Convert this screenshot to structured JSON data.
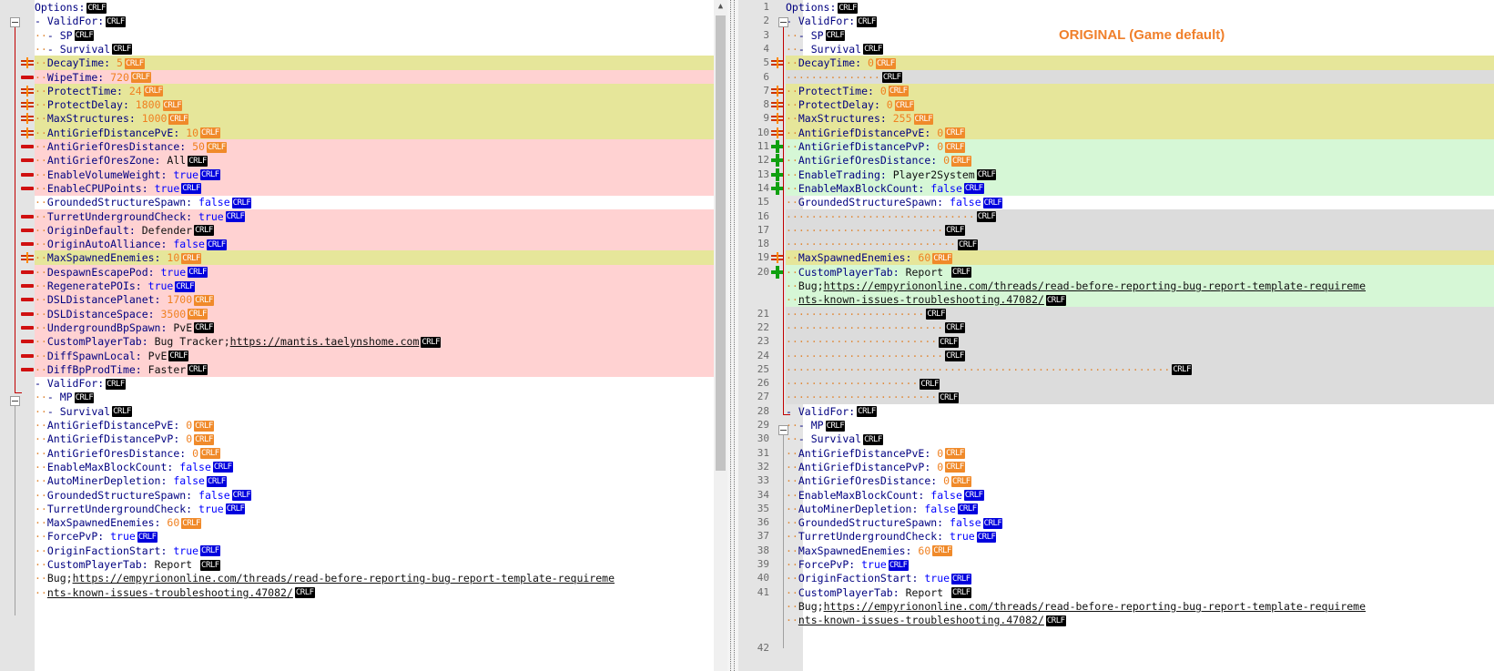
{
  "annotation": "ORIGINAL (Game default)",
  "colors": {
    "deleted": "#ffd2d2",
    "changed": "#e6e69a",
    "added": "#d6f7d6",
    "padding": "#dcdcdc",
    "annotation": "#f07f2a"
  },
  "left": {
    "rows": [
      {
        "t": "n",
        "i": 0,
        "k": "Options:",
        "e": "k"
      },
      {
        "t": "n",
        "i": 0,
        "k": "- ValidFor:",
        "e": "k"
      },
      {
        "t": "n",
        "i": 2,
        "k": "- SP",
        "e": "k"
      },
      {
        "t": "n",
        "i": 2,
        "k": "- Survival",
        "e": "k"
      },
      {
        "t": "c",
        "i": 2,
        "k": "DecayTime: ",
        "v": "5",
        "vt": "n"
      },
      {
        "t": "d",
        "i": 2,
        "k": "WipeTime: ",
        "v": "720",
        "vt": "n"
      },
      {
        "t": "c",
        "i": 2,
        "k": "ProtectTime: ",
        "v": "24",
        "vt": "n"
      },
      {
        "t": "c",
        "i": 2,
        "k": "ProtectDelay: ",
        "v": "1800",
        "vt": "n"
      },
      {
        "t": "c",
        "i": 2,
        "k": "MaxStructures: ",
        "v": "1000",
        "vt": "n"
      },
      {
        "t": "c",
        "i": 2,
        "k": "AntiGriefDistancePvE: ",
        "v": "10",
        "vt": "n"
      },
      {
        "t": "d",
        "i": 2,
        "k": "AntiGriefOresDistance: ",
        "v": "50",
        "vt": "n"
      },
      {
        "t": "d",
        "i": 2,
        "k": "AntiGriefOresZone: ",
        "v": "All",
        "vt": "s"
      },
      {
        "t": "d",
        "i": 2,
        "k": "EnableVolumeWeight: ",
        "v": "true",
        "vt": "b"
      },
      {
        "t": "d",
        "i": 2,
        "k": "EnableCPUPoints: ",
        "v": "true",
        "vt": "b"
      },
      {
        "t": "n",
        "i": 2,
        "k": "GroundedStructureSpawn: ",
        "v": "false",
        "vt": "b"
      },
      {
        "t": "d",
        "i": 2,
        "k": "TurretUndergroundCheck: ",
        "v": "true",
        "vt": "b"
      },
      {
        "t": "d",
        "i": 2,
        "k": "OriginDefault: ",
        "v": "Defender",
        "vt": "s"
      },
      {
        "t": "d",
        "i": 2,
        "k": "OriginAutoAlliance: ",
        "v": "false",
        "vt": "b"
      },
      {
        "t": "c",
        "i": 2,
        "k": "MaxSpawnedEnemies: ",
        "v": "10",
        "vt": "n"
      },
      {
        "t": "d",
        "i": 2,
        "k": "DespawnEscapePod: ",
        "v": "true",
        "vt": "b"
      },
      {
        "t": "d",
        "i": 2,
        "k": "RegeneratePOIs: ",
        "v": "true",
        "vt": "b"
      },
      {
        "t": "d",
        "i": 2,
        "k": "DSLDistancePlanet: ",
        "v": "1700",
        "vt": "n"
      },
      {
        "t": "d",
        "i": 2,
        "k": "DSLDistanceSpace: ",
        "v": "3500",
        "vt": "n"
      },
      {
        "t": "d",
        "i": 2,
        "k": "UndergroundBpSpawn: ",
        "v": "PvE",
        "vt": "s"
      },
      {
        "t": "d",
        "i": 2,
        "k": "CustomPlayerTab: ",
        "v": "Bug Tracker;",
        "vt": "s",
        "u": "https://mantis.taelynshome.com"
      },
      {
        "t": "d",
        "i": 2,
        "k": "DiffSpawnLocal: ",
        "v": "PvE",
        "vt": "s"
      },
      {
        "t": "d",
        "i": 2,
        "k": "DiffBpProdTime: ",
        "v": "Faster",
        "vt": "s"
      },
      {
        "t": "n",
        "i": 0,
        "k": "- ValidFor:",
        "e": "k"
      },
      {
        "t": "n",
        "i": 2,
        "k": "- MP",
        "e": "k"
      },
      {
        "t": "n",
        "i": 2,
        "k": "- Survival",
        "e": "k"
      },
      {
        "t": "n",
        "i": 2,
        "k": "AntiGriefDistancePvE: ",
        "v": "0",
        "vt": "n"
      },
      {
        "t": "n",
        "i": 2,
        "k": "AntiGriefDistancePvP: ",
        "v": "0",
        "vt": "n"
      },
      {
        "t": "n",
        "i": 2,
        "k": "AntiGriefOresDistance: ",
        "v": "0",
        "vt": "n"
      },
      {
        "t": "n",
        "i": 2,
        "k": "EnableMaxBlockCount: ",
        "v": "false",
        "vt": "b"
      },
      {
        "t": "n",
        "i": 2,
        "k": "AutoMinerDepletion: ",
        "v": "false",
        "vt": "b"
      },
      {
        "t": "n",
        "i": 2,
        "k": "GroundedStructureSpawn: ",
        "v": "false",
        "vt": "b"
      },
      {
        "t": "n",
        "i": 2,
        "k": "TurretUndergroundCheck: ",
        "v": "true",
        "vt": "b"
      },
      {
        "t": "n",
        "i": 2,
        "k": "MaxSpawnedEnemies: ",
        "v": "60",
        "vt": "n"
      },
      {
        "t": "n",
        "i": 2,
        "k": "ForcePvP: ",
        "v": "true",
        "vt": "b"
      },
      {
        "t": "n",
        "i": 2,
        "k": "OriginFactionStart: ",
        "v": "true",
        "vt": "b"
      },
      {
        "t": "n",
        "i": 2,
        "k": "CustomPlayerTab: ",
        "v": "Report ",
        "vt": "s"
      },
      {
        "t": "w",
        "i": 2,
        "v": "Bug;",
        "u": "https://empyriononline.com/threads/read-before-reporting-bug-report-template-requireme"
      },
      {
        "t": "w",
        "i": 2,
        "u": "nts-known-issues-troubleshooting.47082/",
        "e": "k"
      }
    ]
  },
  "right": {
    "rows": [
      {
        "ln": "1",
        "t": "n",
        "i": 0,
        "k": "Options:",
        "e": "k"
      },
      {
        "ln": "2",
        "t": "n",
        "i": 0,
        "k": "- ValidFor:",
        "e": "k"
      },
      {
        "ln": "3",
        "t": "n",
        "i": 2,
        "k": "- SP",
        "e": "k"
      },
      {
        "ln": "4",
        "t": "n",
        "i": 2,
        "k": "- Survival",
        "e": "k"
      },
      {
        "ln": "5",
        "t": "c",
        "i": 2,
        "k": "DecayTime: ",
        "v": "0",
        "vt": "n"
      },
      {
        "ln": "6",
        "t": "p",
        "i": 15,
        "e": "k"
      },
      {
        "ln": "7",
        "t": "c",
        "i": 2,
        "k": "ProtectTime: ",
        "v": "0",
        "vt": "n"
      },
      {
        "ln": "8",
        "t": "c",
        "i": 2,
        "k": "ProtectDelay: ",
        "v": "0",
        "vt": "n"
      },
      {
        "ln": "9",
        "t": "c",
        "i": 2,
        "k": "MaxStructures: ",
        "v": "255",
        "vt": "n"
      },
      {
        "ln": "10",
        "t": "c",
        "i": 2,
        "k": "AntiGriefDistancePvE: ",
        "v": "0",
        "vt": "n"
      },
      {
        "ln": "11",
        "t": "a",
        "i": 2,
        "k": "AntiGriefDistancePvP: ",
        "v": "0",
        "vt": "n"
      },
      {
        "ln": "12",
        "t": "a",
        "i": 2,
        "k": "AntiGriefOresDistance: ",
        "v": "0",
        "vt": "n"
      },
      {
        "ln": "13",
        "t": "a",
        "i": 2,
        "k": "EnableTrading: ",
        "v": "Player2System",
        "vt": "s"
      },
      {
        "ln": "14",
        "t": "a",
        "i": 2,
        "k": "EnableMaxBlockCount: ",
        "v": "false",
        "vt": "b"
      },
      {
        "ln": "15",
        "t": "n",
        "i": 2,
        "k": "GroundedStructureSpawn: ",
        "v": "false",
        "vt": "b"
      },
      {
        "ln": "16",
        "t": "p",
        "i": 30,
        "e": "k"
      },
      {
        "ln": "17",
        "t": "p",
        "i": 25,
        "e": "k"
      },
      {
        "ln": "18",
        "t": "p",
        "i": 27,
        "e": "k"
      },
      {
        "ln": "19",
        "t": "c",
        "i": 2,
        "k": "MaxSpawnedEnemies: ",
        "v": "60",
        "vt": "n"
      },
      {
        "ln": "20",
        "t": "a",
        "i": 2,
        "k": "CustomPlayerTab: ",
        "v": "Report ",
        "vt": "s"
      },
      {
        "ln": "",
        "t": "a",
        "i": 2,
        "v": "Bug;",
        "u": "https://empyriononline.com/threads/read-before-reporting-bug-report-template-requireme"
      },
      {
        "ln": "",
        "t": "a",
        "i": 2,
        "u": "nts-known-issues-troubleshooting.47082/",
        "e": "k"
      },
      {
        "ln": "21",
        "t": "p",
        "i": 22,
        "e": "k"
      },
      {
        "ln": "22",
        "t": "p",
        "i": 25,
        "e": "k"
      },
      {
        "ln": "23",
        "t": "p",
        "i": 24,
        "e": "k"
      },
      {
        "ln": "24",
        "t": "p",
        "i": 25,
        "e": "k"
      },
      {
        "ln": "25",
        "t": "p",
        "i": 61,
        "e": "k"
      },
      {
        "ln": "26",
        "t": "p",
        "i": 21,
        "e": "k"
      },
      {
        "ln": "27",
        "t": "p",
        "i": 24,
        "e": "k"
      },
      {
        "ln": "28",
        "t": "n",
        "i": 0,
        "k": "- ValidFor:",
        "e": "k"
      },
      {
        "ln": "29",
        "t": "n",
        "i": 2,
        "k": "- MP",
        "e": "k"
      },
      {
        "ln": "30",
        "t": "n",
        "i": 2,
        "k": "- Survival",
        "e": "k"
      },
      {
        "ln": "31",
        "t": "n",
        "i": 2,
        "k": "AntiGriefDistancePvE: ",
        "v": "0",
        "vt": "n"
      },
      {
        "ln": "32",
        "t": "n",
        "i": 2,
        "k": "AntiGriefDistancePvP: ",
        "v": "0",
        "vt": "n"
      },
      {
        "ln": "33",
        "t": "n",
        "i": 2,
        "k": "AntiGriefOresDistance: ",
        "v": "0",
        "vt": "n"
      },
      {
        "ln": "34",
        "t": "n",
        "i": 2,
        "k": "EnableMaxBlockCount: ",
        "v": "false",
        "vt": "b"
      },
      {
        "ln": "35",
        "t": "n",
        "i": 2,
        "k": "AutoMinerDepletion: ",
        "v": "false",
        "vt": "b"
      },
      {
        "ln": "36",
        "t": "n",
        "i": 2,
        "k": "GroundedStructureSpawn: ",
        "v": "false",
        "vt": "b"
      },
      {
        "ln": "37",
        "t": "n",
        "i": 2,
        "k": "TurretUndergroundCheck: ",
        "v": "true",
        "vt": "b"
      },
      {
        "ln": "38",
        "t": "n",
        "i": 2,
        "k": "MaxSpawnedEnemies: ",
        "v": "60",
        "vt": "n"
      },
      {
        "ln": "39",
        "t": "n",
        "i": 2,
        "k": "ForcePvP: ",
        "v": "true",
        "vt": "b"
      },
      {
        "ln": "40",
        "t": "n",
        "i": 2,
        "k": "OriginFactionStart: ",
        "v": "true",
        "vt": "b"
      },
      {
        "ln": "41",
        "t": "n",
        "i": 2,
        "k": "CustomPlayerTab: ",
        "v": "Report ",
        "vt": "s"
      },
      {
        "ln": "",
        "t": "w",
        "i": 2,
        "v": "Bug;",
        "u": "https://empyriononline.com/threads/read-before-reporting-bug-report-template-requireme"
      },
      {
        "ln": "",
        "t": "w",
        "i": 2,
        "u": "nts-known-issues-troubleshooting.47082/",
        "e": "k"
      },
      {
        "ln": "",
        "t": "b"
      },
      {
        "ln": "42",
        "t": "n",
        "i": 0
      }
    ]
  }
}
